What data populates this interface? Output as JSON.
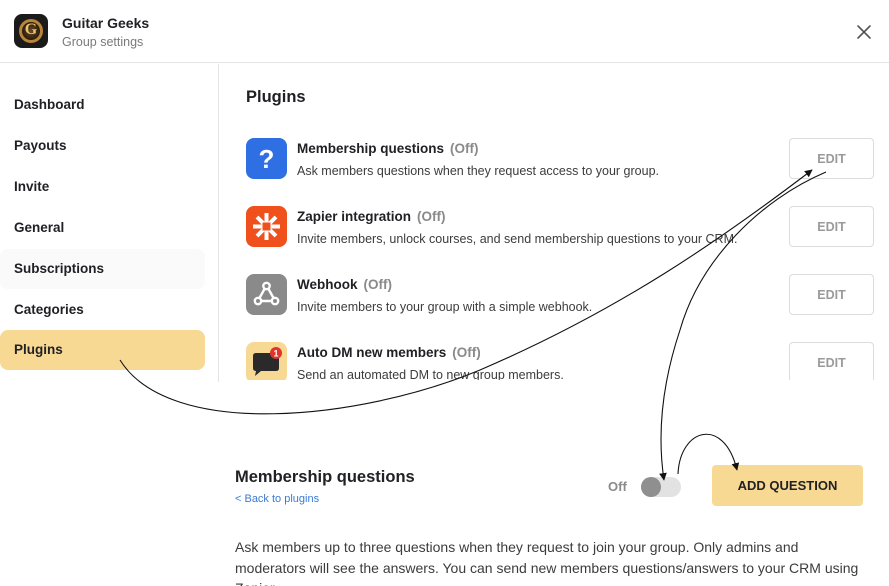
{
  "header": {
    "group_name": "Guitar Geeks",
    "subtitle": "Group settings",
    "logo_letter": "G",
    "close_icon": "close-icon"
  },
  "sidebar": {
    "items": [
      {
        "label": "Dashboard",
        "active": false
      },
      {
        "label": "Payouts",
        "active": false
      },
      {
        "label": "Invite",
        "active": false
      },
      {
        "label": "General",
        "active": false
      },
      {
        "label": "Subscriptions",
        "active": false
      },
      {
        "label": "Categories",
        "active": false
      },
      {
        "label": "Plugins",
        "active": true
      }
    ]
  },
  "plugins": {
    "title": "Plugins",
    "edit_label": "EDIT",
    "items": [
      {
        "name": "Membership questions",
        "status": "(Off)",
        "description": "Ask members questions when they request access to your group.",
        "icon": "question-mark-icon",
        "icon_color": "#2f6fe4"
      },
      {
        "name": "Zapier integration",
        "status": "(Off)",
        "description": "Invite members, unlock courses, and send membership questions to your CRM.",
        "icon": "zapier-icon",
        "icon_color": "#f0501c"
      },
      {
        "name": "Webhook",
        "status": "(Off)",
        "description": "Invite members to your group with a simple webhook.",
        "icon": "webhook-icon",
        "icon_color": "#8a8a8a"
      },
      {
        "name": "Auto DM new members",
        "status": "(Off)",
        "description": "Send an automated DM to new group members.",
        "icon": "chat-bubble-icon",
        "icon_color": "#f8d993",
        "badge": "1"
      }
    ]
  },
  "membership_questions": {
    "title": "Membership questions",
    "back_link": "< Back to plugins",
    "toggle_label": "Off",
    "toggle_on": false,
    "add_button": "ADD QUESTION",
    "description": "Ask members up to three questions when they request to join your group. Only admins and moderators will see the answers. You can send new members questions/answers to your CRM using Zapier."
  },
  "colors": {
    "accent": "#f8d993",
    "link": "#3a7bd5",
    "muted": "#8a8a8a"
  }
}
